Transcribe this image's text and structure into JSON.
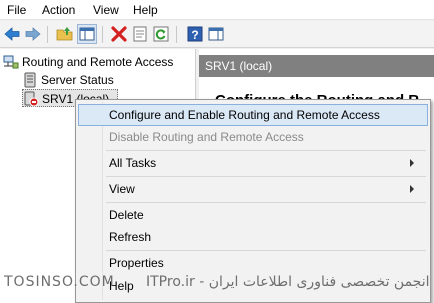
{
  "menubar": {
    "items": [
      "File",
      "Action",
      "View",
      "Help"
    ]
  },
  "toolbar": {
    "icons": [
      "back-arrow-icon",
      "forward-arrow-icon",
      "up-folder-icon",
      "show-hide-console-tree-icon",
      "delete-icon",
      "properties-icon",
      "refresh-icon",
      "help-icon",
      "show-action-pane-icon"
    ]
  },
  "tree": {
    "root": "Routing and Remote Access",
    "server_status": "Server Status",
    "server": "SRV1 (local)"
  },
  "rpane": {
    "header": "SRV1 (local)",
    "title": "Configure the Routing and R"
  },
  "context_menu": {
    "items": [
      "Configure and Enable Routing and Remote Access",
      "Disable Routing and Remote Access",
      "All Tasks",
      "View",
      "Delete",
      "Refresh",
      "Properties",
      "Help"
    ]
  },
  "watermark": {
    "left": "TOSINSO.COM",
    "right": "انجمن تخصصی فناوری اطلاعات ایران - ITPro.ir"
  },
  "colors": {
    "highlight": "#dbe8f6",
    "header_gray": "#808080"
  }
}
